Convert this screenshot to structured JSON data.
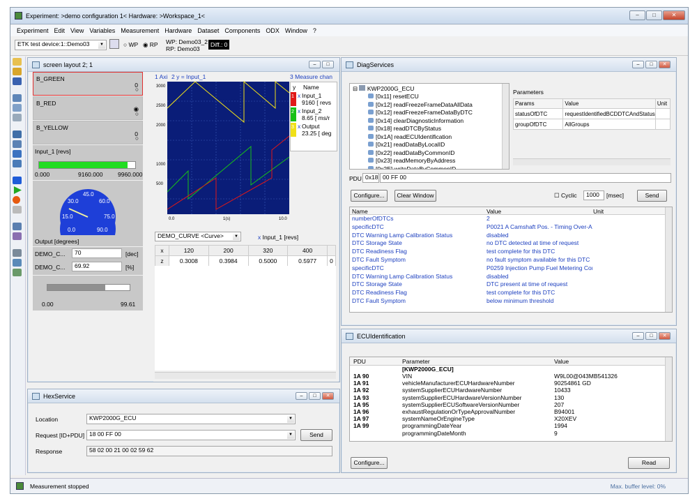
{
  "app": {
    "title": "Experiment: >demo configuration 1< Hardware: >Workspace_1<"
  },
  "menu": [
    "Experiment",
    "Edit",
    "View",
    "Variables",
    "Measurement",
    "Hardware",
    "Dataset",
    "Components",
    "ODX",
    "Window",
    "?"
  ],
  "toolbar": {
    "device": "ETK test device:1::Demo03",
    "wp_label": "WP",
    "rp_label": "RP",
    "wp_value": "WP: Demo03_2",
    "rp_value": "RP: Demo03",
    "diff": "Diff.: 0"
  },
  "screen": {
    "title": "screen layout 2; 1",
    "bits": [
      {
        "label": "B_GREEN",
        "value": "0"
      },
      {
        "label": "B_RED",
        "value": ""
      },
      {
        "label": "B_YELLOW",
        "value": "0"
      }
    ],
    "bar": {
      "label": "Input_1  [revs]",
      "min": "0.000",
      "mid": "9160.000",
      "max": "9960.000",
      "fraction": 0.92
    },
    "gauge": {
      "ticks": [
        "0.0",
        "15.0",
        "30.0",
        "45.0",
        "60.0",
        "75.0",
        "90.0"
      ],
      "label": "Output  [degrees]"
    },
    "calib": [
      {
        "name": "DEMO_C...",
        "value": "70",
        "unit": "[dec]"
      },
      {
        "name": "DEMO_C...",
        "value": "69.92",
        "unit": "[%]"
      }
    ],
    "slider": {
      "min": "0.00",
      "max": "99.61",
      "fraction": 0.7
    },
    "oscillo": {
      "tab1": "1 Axi",
      "tab2": "2  y = Input_1",
      "yticks": [
        "3000",
        "2500",
        "2000",
        "1500",
        "1000",
        "500",
        "0"
      ],
      "xticks": [
        "0.0",
        "10.0"
      ],
      "xmid": "1(s)",
      "legend_tab": "3 Measure chan",
      "col_y": "y",
      "col_name": "Name",
      "channels": [
        {
          "num": "1",
          "name": "Input_1",
          "value": "9160  [ revs",
          "color": "#e01818"
        },
        {
          "num": "2",
          "name": "Input_2",
          "value": "8.65  [ ms/r",
          "color": "#18c018"
        },
        {
          "num": "3",
          "name": "Output",
          "value": "23.25  [ deg",
          "color": "#f0e018"
        }
      ]
    },
    "curve": {
      "select": "DEMO_CURVE <Curve>",
      "ref": "Input_1 [revs]",
      "x_label": "x",
      "z_label": "z",
      "x": [
        "120",
        "200",
        "320",
        "400"
      ],
      "z": [
        "0.3008",
        "0.3984",
        "0.5000",
        "0.5977"
      ],
      "extra": "0"
    }
  },
  "hex": {
    "title": "HexService",
    "location_label": "Location",
    "location_value": "KWP2000G_ECU",
    "request_label": "Request [ID+PDU]",
    "request_value": "18 00 FF 00",
    "send": "Send",
    "response_label": "Response",
    "response_value": "58 02 00 21 00 02 59 62"
  },
  "diag": {
    "title": "DiagServices",
    "root": "KWP2000G_ECU",
    "services": [
      "[0x11] resetECU",
      "[0x12] readFreezeFrameDataAllData",
      "[0x12] readFreezeFrameDataByDTC",
      "[0x14] clearDiagnosticInformation",
      "[0x18] readDTCByStatus",
      "[0x1A] readECUIdentification",
      "[0x21] readDataByLocalID",
      "[0x22] readDataByCommonID",
      "[0x23] readMemoryByAddress",
      "[0x2E] writeDataByCommonID"
    ],
    "params_title": "Parameters",
    "params_head": [
      "Params",
      "Value",
      "Unit"
    ],
    "params": [
      {
        "p": "statusOfDTC",
        "v": "requestIdentifiedBCDDTCAndStatus"
      },
      {
        "p": "groupOfDTC",
        "v": "AllGroups"
      }
    ],
    "pdu_label": "PDU",
    "pdu_id": "0x18",
    "pdu_value": "00 FF 00",
    "configure": "Configure...",
    "clear": "Clear Window",
    "cyclic": "Cyclic",
    "cyclic_value": "1000",
    "msec": "[msec]",
    "send": "Send",
    "result_head": [
      "Name",
      "Value",
      "Unit"
    ],
    "results": [
      {
        "n": "numberOfDTCs",
        "v": "2"
      },
      {
        "n": "specificDTC",
        "v": "P0021 A Camshaft Pos. - Timing Over-Adva"
      },
      {
        "n": "DTC Warning Lamp Calibration Status",
        "v": "disabled"
      },
      {
        "n": "DTC Storage State",
        "v": "no DTC detected at time of request"
      },
      {
        "n": "DTC Readiness Flag",
        "v": "test complete for this DTC"
      },
      {
        "n": "DTC Fault Symptom",
        "v": "no fault symptom available for this DTC"
      },
      {
        "n": "specificDTC",
        "v": "P0259 Injection Pump Fuel Metering Contro"
      },
      {
        "n": "DTC Warning Lamp Calibration Status",
        "v": "disabled"
      },
      {
        "n": "DTC Storage State",
        "v": "DTC present at time of request"
      },
      {
        "n": "DTC Readiness Flag",
        "v": "test complete for this DTC"
      },
      {
        "n": "DTC Fault Symptom",
        "v": "below minimum threshold"
      }
    ]
  },
  "ecu": {
    "title": "ECUIdentification",
    "head": [
      "PDU",
      "Parameter",
      "Value"
    ],
    "group": "[KWP2000G_ECU]",
    "rows": [
      {
        "pdu": "1A 90",
        "p": "VIN",
        "v": "W9L00@043MB541326"
      },
      {
        "pdu": "1A 91",
        "p": "vehicleManufacturerECUHardwareNumber",
        "v": "90254861 GD"
      },
      {
        "pdu": "1A 92",
        "p": "systemSupplierECUHardwareNumber",
        "v": "10433"
      },
      {
        "pdu": "1A 93",
        "p": "systemSupplierECUHardwareVersionNumber",
        "v": "130"
      },
      {
        "pdu": "1A 95",
        "p": "systemSupplierECUSoftwareVersionNumber",
        "v": "207"
      },
      {
        "pdu": "1A 96",
        "p": "exhaustRegulationOrTypeApprovalNumber",
        "v": "B94001"
      },
      {
        "pdu": "1A 97",
        "p": "systemNameOrEngineType",
        "v": "X20XEV"
      },
      {
        "pdu": "1A 99",
        "p": "programmingDateYear",
        "v": "1994"
      },
      {
        "pdu": "",
        "p": "programmingDateMonth",
        "v": "9"
      }
    ],
    "configure": "Configure...",
    "read": "Read"
  },
  "status": {
    "left": "Measurement stopped",
    "right": "Max. buffer level: 0%"
  },
  "colors": {
    "osc_bg": "#0a1d78",
    "bar_green": "#22dd22",
    "gauge_blue": "#1e3fd8"
  }
}
